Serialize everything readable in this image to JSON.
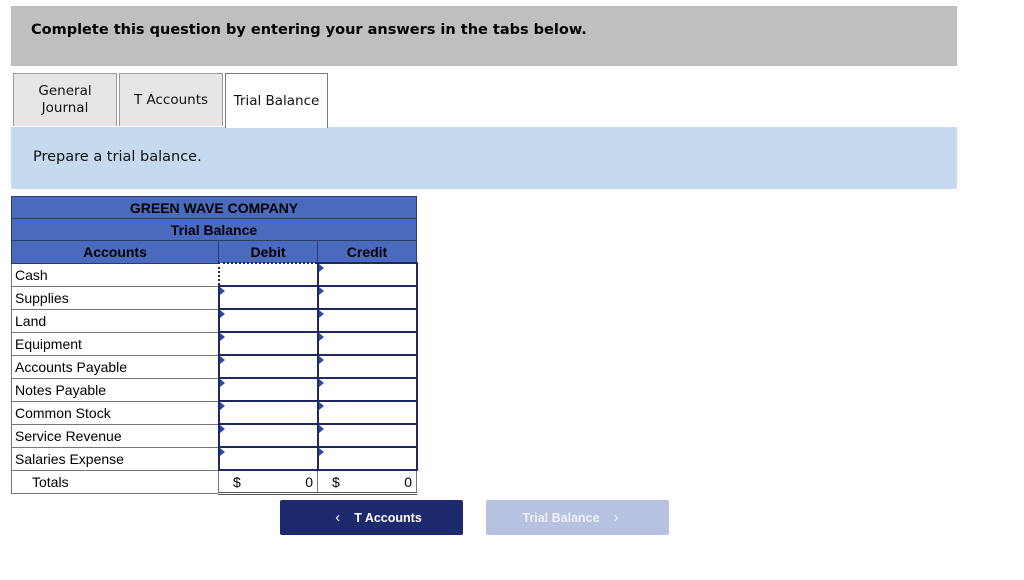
{
  "banner": {
    "text": "Complete this question by entering your answers in the tabs below."
  },
  "tabs": [
    {
      "label_line1": "General",
      "label_line2": "Journal",
      "active": false
    },
    {
      "label": "T Accounts",
      "active": false
    },
    {
      "label": "Trial Balance",
      "active": true
    }
  ],
  "instruction": "Prepare a trial balance.",
  "trial_balance": {
    "company": "GREEN WAVE COMPANY",
    "title": "Trial Balance",
    "headers": {
      "accounts": "Accounts",
      "debit": "Debit",
      "credit": "Credit"
    },
    "rows": [
      {
        "account": "Cash",
        "debit": "",
        "credit": ""
      },
      {
        "account": "Supplies",
        "debit": "",
        "credit": ""
      },
      {
        "account": "Land",
        "debit": "",
        "credit": ""
      },
      {
        "account": "Equipment",
        "debit": "",
        "credit": ""
      },
      {
        "account": "Accounts Payable",
        "debit": "",
        "credit": ""
      },
      {
        "account": "Notes Payable",
        "debit": "",
        "credit": ""
      },
      {
        "account": "Common Stock",
        "debit": "",
        "credit": ""
      },
      {
        "account": "Service Revenue",
        "debit": "",
        "credit": ""
      },
      {
        "account": "Salaries Expense",
        "debit": "",
        "credit": ""
      }
    ],
    "totals": {
      "label": "Totals",
      "currency": "$",
      "debit": "0",
      "credit": "0"
    }
  },
  "nav": {
    "prev_label": "T Accounts",
    "prev_icon": "‹",
    "next_label": "Trial Balance",
    "next_icon": "›"
  },
  "colors": {
    "header_blue": "#4a6bbd",
    "nav_dark": "#1d2a6e",
    "nav_disabled": "#b6c2df",
    "instruction_bg": "#c5d9ef"
  }
}
